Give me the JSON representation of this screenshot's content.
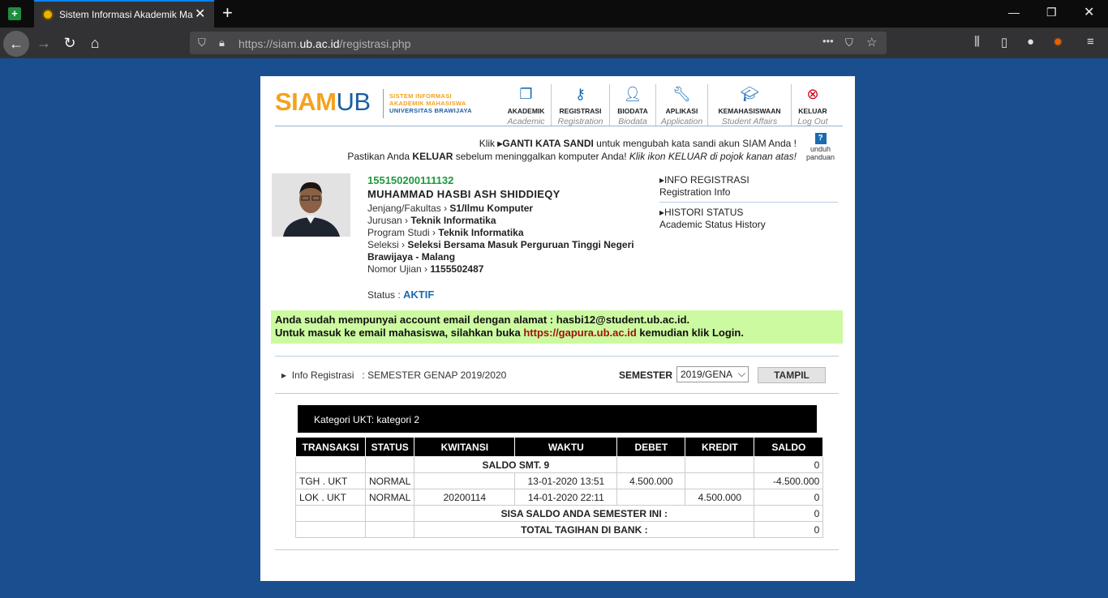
{
  "browser": {
    "tab_title": "Sistem Informasi Akademik Ma",
    "url_prefix": "https://siam.",
    "url_domain": "ub.ac.id",
    "url_path": "/registrasi.php"
  },
  "logo": {
    "siam": "SIAM",
    "ub": "UB",
    "sub1": "SISTEM INFORMASI",
    "sub2": "AKADEMIK MAHASISWA",
    "sub3": "UNIVERSITAS BRAWIJAYA"
  },
  "menu": [
    {
      "label": "AKADEMIK",
      "en": "Academic",
      "icon": "documents-icon"
    },
    {
      "label": "REGISTRASI",
      "en": "Registration",
      "icon": "key-icon"
    },
    {
      "label": "BIODATA",
      "en": "Biodata",
      "icon": "user-icon"
    },
    {
      "label": "APLIKASI",
      "en": "Application",
      "icon": "wrench-icon"
    },
    {
      "label": "KEMAHASISWAAN",
      "en": "Student Affairs",
      "icon": "graduation-cap-icon"
    },
    {
      "label": "KELUAR",
      "en": "Log Out",
      "icon": "close-circle-icon"
    }
  ],
  "notice": {
    "l1a": "Klik ",
    "l1b": "GANTI KATA SANDI",
    "l1c": " untuk mengubah kata sandi akun SIAM Anda !",
    "l2a": "Pastikan Anda ",
    "l2b": "KELUAR",
    "l2c": " sebelum meninggalkan komputer Anda! ",
    "l2d": "Klik ikon KELUAR di pojok kanan atas!"
  },
  "unduh": {
    "l1": "unduh",
    "l2": "panduan"
  },
  "student": {
    "nim": "155150200111132",
    "nama": "MUHAMMAD HASBI ASH SHIDDIEQY",
    "jenjang_label": "Jenjang/Fakultas",
    "jenjang": "S1/Ilmu Komputer",
    "jurusan_label": "Jurusan",
    "jurusan": "Teknik Informatika",
    "prodi_label": "Program Studi",
    "prodi": "Teknik Informatika",
    "seleksi_label": "Seleksi",
    "seleksi": "Seleksi Bersama Masuk Perguruan Tinggi Negeri Brawijaya - Malang",
    "ujian_label": "Nomor Ujian",
    "ujian": "1155502487",
    "status_label": "Status :",
    "status": "AKTIF"
  },
  "sidelinks": [
    {
      "label": "INFO REGISTRASI",
      "en": "Registration Info"
    },
    {
      "label": "HISTORI STATUS",
      "en": "Academic Status History"
    }
  ],
  "email": {
    "l1": "Anda sudah mempunyai account email dengan alamat : hasbi12@student.ub.ac.id.",
    "l2a": "Untuk masuk ke email mahasiswa, silahkan buka ",
    "l2b": "https://gapura.ub.ac.id",
    "l2c": " kemudian klik Login."
  },
  "reg": {
    "label": "Info Registrasi",
    "value": ":   SEMESTER GENAP 2019/2020",
    "sem_label": "SEMESTER",
    "sem_value": "2019/GENA",
    "button": "TAMPIL"
  },
  "ukt": "Kategori UKT: kategori 2",
  "table": {
    "headers": [
      "TRANSAKSI",
      "STATUS",
      "KWITANSI",
      "WAKTU",
      "DEBET",
      "KREDIT",
      "SALDO"
    ],
    "saldo_row": {
      "label": "SALDO SMT. 9",
      "saldo": "0"
    },
    "rows": [
      [
        "TGH . UKT",
        "NORMAL",
        "",
        "13-01-2020 13:51",
        "4.500.000",
        "",
        "-4.500.000"
      ],
      [
        "LOK . UKT",
        "NORMAL",
        "20200114",
        "14-01-2020 22:11",
        "",
        "4.500.000",
        "0"
      ]
    ],
    "sisa": {
      "label": "SISA SALDO ANDA SEMESTER INI :",
      "value": "0"
    },
    "total": {
      "label": "TOTAL TAGIHAN DI BANK :",
      "value": "0"
    }
  }
}
